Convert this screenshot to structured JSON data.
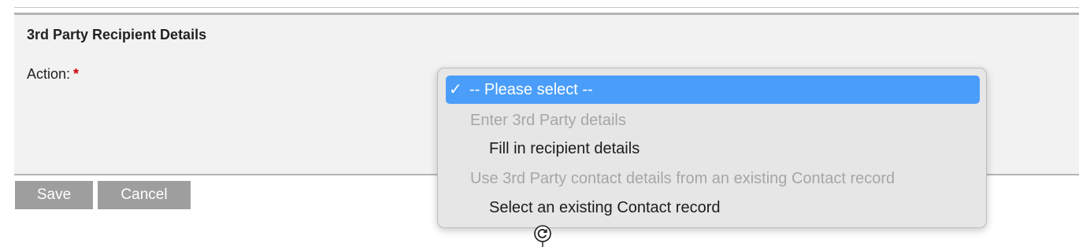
{
  "section": {
    "title": "3rd Party Recipient Details",
    "action_label": "Action:",
    "required_marker": "*"
  },
  "buttons": {
    "save": "Save",
    "cancel": "Cancel"
  },
  "dropdown": {
    "selected_check": "✓",
    "options": [
      {
        "label": "-- Please select --",
        "type": "option",
        "selected": true
      },
      {
        "label": "Enter 3rd Party details",
        "type": "group"
      },
      {
        "label": "Fill in recipient details",
        "type": "option"
      },
      {
        "label": "Use 3rd Party contact details from an existing Contact record",
        "type": "group"
      },
      {
        "label": "Select an existing Contact record",
        "type": "option"
      }
    ]
  },
  "colors": {
    "selected_bg": "#4a9ef9",
    "required": "#cc0000",
    "button_bg": "#9e9e9e",
    "panel_bg": "#f2f2f2",
    "dropdown_bg": "#e6e6e6"
  },
  "icons": {
    "cursor": "resize-cursor-icon"
  }
}
